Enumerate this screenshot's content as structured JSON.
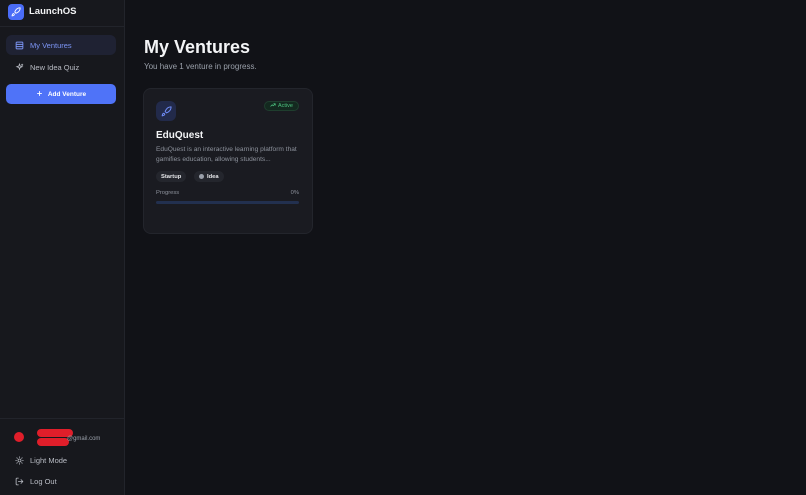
{
  "app": {
    "name": "LaunchOS",
    "brand_color": "#4a6cf7"
  },
  "sidebar": {
    "nav": [
      {
        "label": "My Ventures",
        "icon": "grid-icon",
        "active": true
      },
      {
        "label": "New Idea Quiz",
        "icon": "sparkles-icon",
        "active": false
      }
    ],
    "add_button": {
      "label": "Add Venture",
      "icon": "plus-icon"
    },
    "user": {
      "email": "@gmail.com"
    },
    "bottom": [
      {
        "label": "Light Mode",
        "icon": "sun-icon"
      },
      {
        "label": "Log Out",
        "icon": "log-out-icon"
      }
    ]
  },
  "main": {
    "title": "My Ventures",
    "subtitle": "You have 1 venture in progress.",
    "ventures": [
      {
        "name": "EduQuest",
        "icon": "rocket-icon",
        "status": "Active",
        "status_color": "#4cc27f",
        "description": "EduQuest is an interactive learning platform that gamifies education, allowing students...",
        "tags": [
          "Startup",
          "Idea"
        ],
        "progress_label": "Progress",
        "progress_text": "0%",
        "progress_value": 0
      }
    ]
  }
}
